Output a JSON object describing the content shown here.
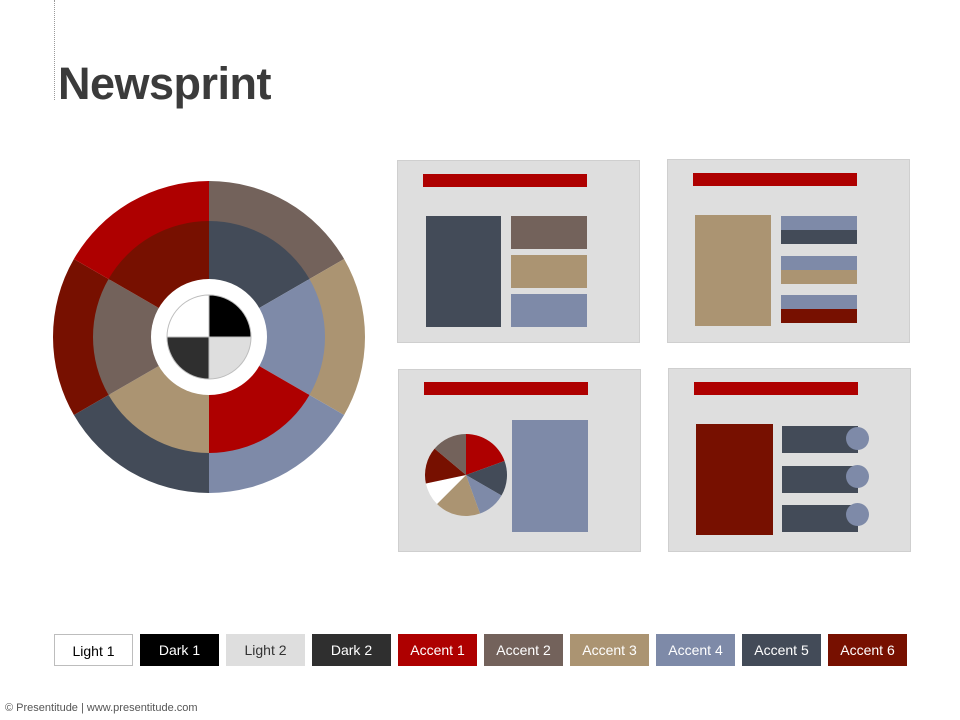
{
  "title": "Newsprint",
  "colors": {
    "light1": "#ffffff",
    "dark1": "#000000",
    "light2": "#dedede",
    "dark2": "#2f2f2f",
    "accent1": "#ae0000",
    "accent2": "#73625b",
    "accent3": "#ab9472",
    "accent4": "#7e8aa8",
    "accent5": "#434b58",
    "accent6": "#771000"
  },
  "swatches": [
    {
      "label": "Light 1",
      "color": "#ffffff",
      "text_color": "#000000",
      "outlined": true
    },
    {
      "label": "Dark 1",
      "color": "#000000",
      "text_color": "#ffffff"
    },
    {
      "label": "Light 2",
      "color": "#dedede",
      "text_color": "#333333"
    },
    {
      "label": "Dark 2",
      "color": "#2f2f2f",
      "text_color": "#ffffff"
    },
    {
      "label": "Accent 1",
      "color": "#ae0000",
      "text_color": "#ffffff"
    },
    {
      "label": "Accent 2",
      "color": "#73625b",
      "text_color": "#ffffff"
    },
    {
      "label": "Accent 3",
      "color": "#ab9472",
      "text_color": "#ffffff"
    },
    {
      "label": "Accent 4",
      "color": "#7e8aa8",
      "text_color": "#ffffff"
    },
    {
      "label": "Accent 5",
      "color": "#434b58",
      "text_color": "#ffffff"
    },
    {
      "label": "Accent 6",
      "color": "#771000",
      "text_color": "#ffffff"
    }
  ],
  "footer": "© Presentitude | www.presentitude.com"
}
